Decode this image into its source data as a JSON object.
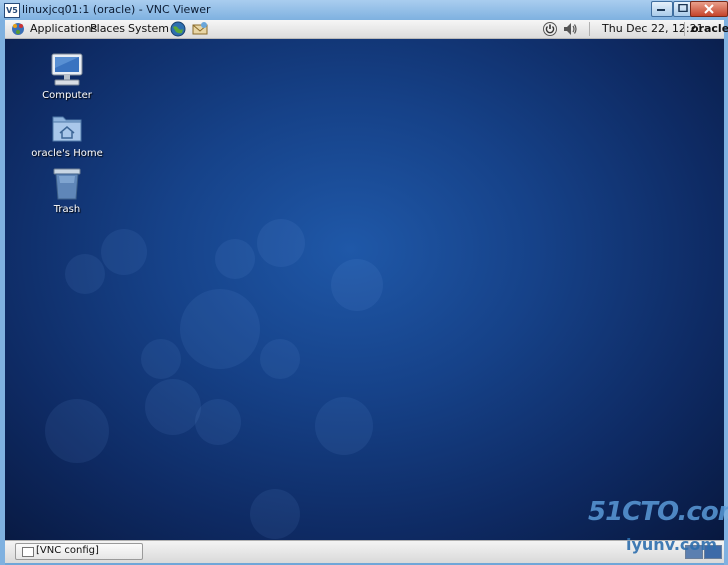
{
  "window": {
    "icon_text": "V5",
    "title": "linuxjcq01:1 (oracle) - VNC Viewer"
  },
  "top_panel": {
    "menus": [
      "Applications",
      "Places",
      "System"
    ],
    "clock": "Thu Dec 22, 12:21",
    "user": "oracle"
  },
  "desktop": {
    "icons": [
      {
        "label": "Computer",
        "icon": "computer-icon"
      },
      {
        "label": "oracle's Home",
        "icon": "home-folder-icon"
      },
      {
        "label": "Trash",
        "icon": "trash-icon"
      }
    ]
  },
  "bottom_panel": {
    "taskbar_items": [
      "[VNC config]"
    ]
  },
  "watermark": {
    "line1": "51CTO.com",
    "line2": "iyunv.com"
  }
}
